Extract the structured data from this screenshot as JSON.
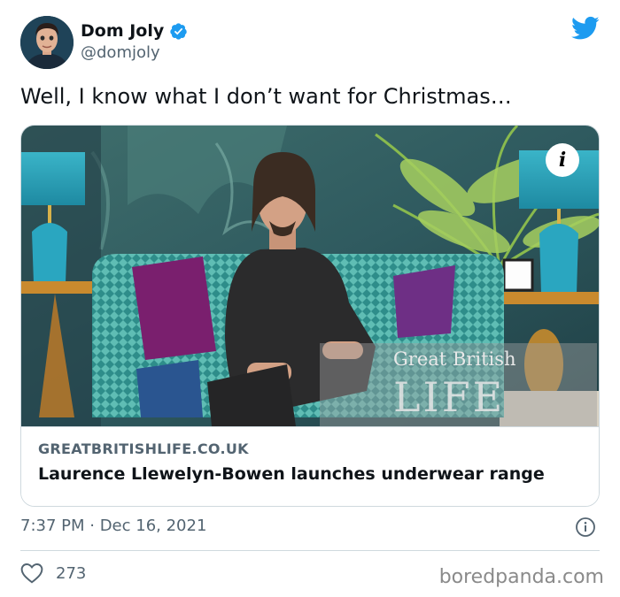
{
  "author": {
    "display_name": "Dom Joly",
    "handle": "@domjoly",
    "verified": true
  },
  "tweet": {
    "text": "Well, I know what I don’t want for Christmas…",
    "timestamp": "7:37 PM · Dec 16, 2021",
    "likes": "273"
  },
  "card": {
    "domain": "GREATBRITISHLIFE.CO.UK",
    "title": "Laurence Llewelyn-Bowen launches underwear range",
    "watermark_top": "Great British",
    "watermark_bottom": "LIFE",
    "info_badge": "i"
  },
  "footer": {
    "watermark": "boredpanda.com"
  },
  "colors": {
    "twitter_blue": "#1d9bf0",
    "text_primary": "#0f1419",
    "text_secondary": "#536471",
    "border": "#cfd9de"
  },
  "icons": {
    "verified": "verified-badge-icon",
    "logo": "twitter-bird-icon",
    "info": "info-circle-icon",
    "like": "heart-icon"
  }
}
